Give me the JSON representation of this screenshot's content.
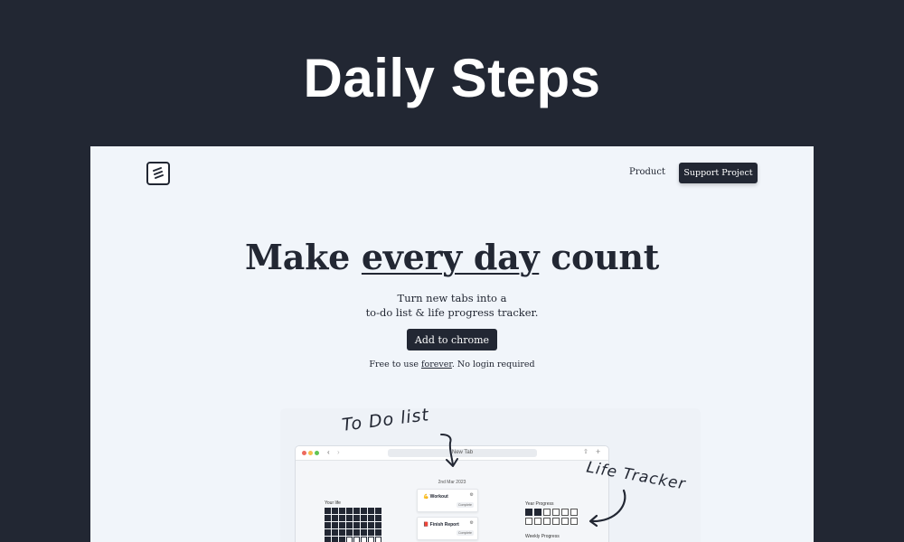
{
  "banner": {
    "title": "Daily Steps"
  },
  "nav": {
    "product": "Product",
    "support": "Support Project"
  },
  "hero": {
    "title_pre": "Make ",
    "title_emph": "every day",
    "title_post": " count",
    "subtitle_line1": "Turn new tabs into a",
    "subtitle_line2": "to-do list & life progress tracker.",
    "cta": "Add to chrome",
    "free_pre": "Free to use ",
    "free_emph": "forever",
    "free_post": ". No login required"
  },
  "annotations": {
    "todo": "To Do list",
    "life": "Life Tracker"
  },
  "preview": {
    "tab_title": "New Tab",
    "date": "2nd Mar 2023",
    "your_life_label": "Your life",
    "year_progress_label": "Year Progress",
    "weekly_progress_label": "Weekly Progress",
    "tasks": [
      {
        "icon": "💪",
        "title": "Workout",
        "status": "Complete"
      },
      {
        "icon": "📕",
        "title": "Finish Report",
        "status": "Complete"
      }
    ]
  },
  "colors": {
    "dark": "#222733",
    "page_bg": "#f1f5fa"
  }
}
